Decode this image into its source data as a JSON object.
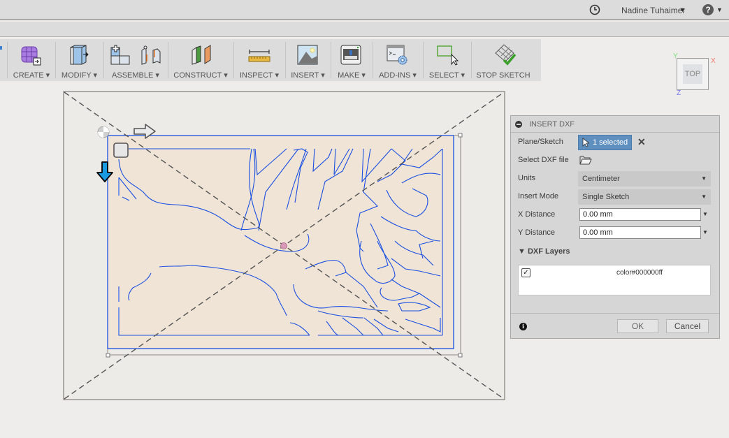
{
  "topbar": {
    "history_icon": "clock-icon",
    "user_name": "Nadine Tuhaimer",
    "user_caret": "▼",
    "help_label": "?",
    "help_caret": "▼"
  },
  "toolbar": {
    "groups": [
      {
        "label": "CREATE ▾",
        "icon": "create-solid-icon"
      },
      {
        "label": "MODIFY ▾",
        "icon": "modify-push-pull-icon"
      },
      {
        "label": "ASSEMBLE ▾",
        "icon": "assemble-joint-icon"
      },
      {
        "label": "CONSTRUCT ▾",
        "icon": "construct-plane-icon"
      },
      {
        "label": "INSPECT ▾",
        "icon": "measure-ruler-icon"
      },
      {
        "label": "INSERT ▾",
        "icon": "insert-image-icon"
      },
      {
        "label": "MAKE ▾",
        "icon": "3d-print-icon"
      },
      {
        "label": "ADD-INS ▾",
        "icon": "scripts-addins-icon"
      },
      {
        "label": "SELECT ▾",
        "icon": "select-window-icon"
      },
      {
        "label": "STOP SKETCH",
        "icon": "stop-sketch-icon"
      }
    ]
  },
  "viewcube": {
    "face": "TOP",
    "axis_x": "X",
    "axis_y": "Y",
    "axis_z": "Z"
  },
  "colors": {
    "sketch_line": "#1a4fe0",
    "accent": "#5e8fbf",
    "canvas_bg": "#eeedeb",
    "sketch_fill": "#efe4d6"
  },
  "dialog": {
    "title": "INSERT DXF",
    "plane_sketch_label": "Plane/Sketch",
    "plane_sketch_value": "1 selected",
    "select_file_label": "Select DXF file",
    "units_label": "Units",
    "units_value": "Centimeter",
    "insert_mode_label": "Insert Mode",
    "insert_mode_value": "Single Sketch",
    "x_distance_label": "X Distance",
    "x_distance_value": "0.00 mm",
    "y_distance_label": "Y Distance",
    "y_distance_value": "0.00 mm",
    "layers_section": "▼ DXF Layers",
    "layers": [
      {
        "name": "color#000000ff",
        "checked": true
      }
    ],
    "ok_label": "OK",
    "cancel_label": "Cancel"
  }
}
